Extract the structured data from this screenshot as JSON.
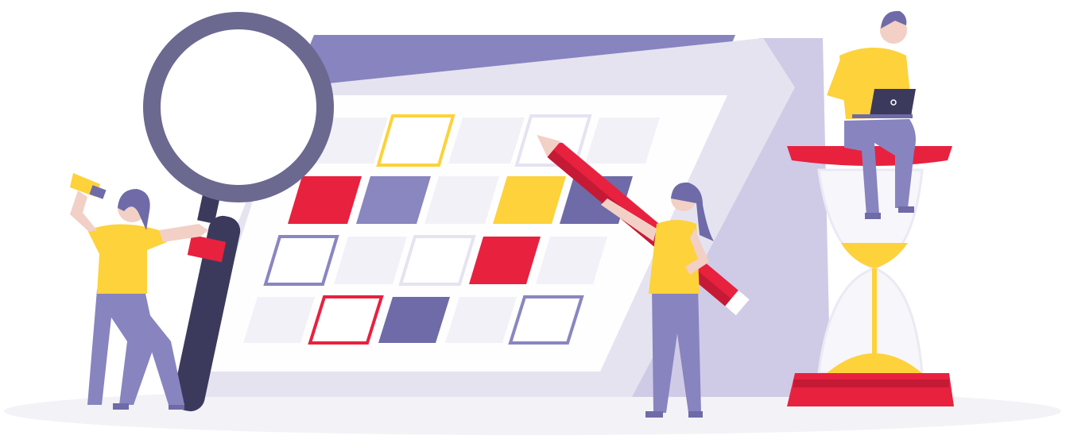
{
  "scene": {
    "subject": "calendar-scheduling-illustration",
    "palette": {
      "purple_dark": "#6f6ba8",
      "purple_mid": "#8a86c0",
      "purple_light": "#cfcbe6",
      "lavender": "#e6e3f1",
      "red": "#e8213f",
      "yellow": "#fdd23b",
      "skin": "#f2d0c6",
      "white": "#ffffff",
      "ground": "#f3f2f7",
      "dark_handle": "#3c3a5c"
    },
    "calendar": {
      "cells": [
        [
          "blank",
          "outline-yellow",
          "blank",
          "outline-gray",
          "blank"
        ],
        [
          "fill-red",
          "fill-purple",
          "blank",
          "fill-yellow",
          "fill-purple"
        ],
        [
          "outline-purple",
          "blank",
          "outline-gray",
          "fill-red",
          "blank"
        ],
        [
          "blank",
          "outline-red",
          "fill-purple",
          "blank",
          "outline-purple"
        ]
      ]
    },
    "figures": [
      "woman-with-megaphone",
      "woman-with-pencil",
      "man-with-laptop"
    ],
    "objects": [
      "magnifying-glass",
      "giant-pencil",
      "hourglass",
      "laptop",
      "megaphone"
    ]
  }
}
